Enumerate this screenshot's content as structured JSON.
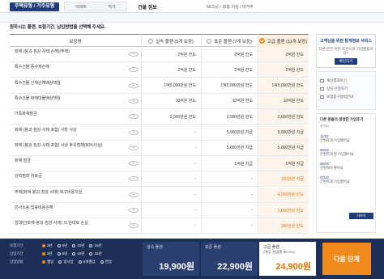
{
  "header": {
    "tab_active": "주택유형 / 거주유형",
    "sub": [
      "아파트",
      "자가"
    ],
    "label": "건물 정보",
    "value": "59.5㎡ / 16층 이상 / 미거주"
  },
  "instruction": "원하시는 플랜, 보험기간, 납입방법을 선택해 주세요.",
  "table": {
    "head": {
      "label": "보장명",
      "plans": [
        {
          "name": "실속 플랜 (5개 보장)",
          "selected": false
        },
        {
          "name": "표준 플랜 (7개 보장)",
          "selected": false
        },
        {
          "name": "고급 플랜 (11개 보장)",
          "selected": true
        }
      ]
    },
    "rows": [
      {
        "name": "화재 (붕괴·침강·사태 손해)(주택)",
        "sub": "",
        "v": [
          "2억원 한도",
          "2억원 한도",
          "2억원 한도"
        ]
      },
      {
        "name": "특수건물 풍수재손해",
        "sub": "",
        "v": [
          "2억원 한도",
          "2억원 한도",
          "2억원 한도"
        ]
      },
      {
        "name": "특수건물 신체손해배상책임",
        "sub": "",
        "v": [
          "1억5,000만원 한도",
          "1억5,000만원 한도",
          "1억5,000만원 한도"
        ]
      },
      {
        "name": "특수건물 화재대물배상책임",
        "sub": "",
        "v": [
          "10억원 한도",
          "10억원 한도",
          "10억원 한도"
        ]
      },
      {
        "name": "가족화재벌금",
        "sub": "",
        "v": [
          "2,000만원 한도",
          "2,000만원 한도",
          "2,000만원 한도"
        ]
      },
      {
        "name": "화재 (붕괴·침강·사태 포함) 사망 사상",
        "sub": "",
        "v": [
          "-",
          "5,000만원 지급",
          "5,000만원 지급"
        ]
      },
      {
        "name": "화재 (붕괴·침강·사태 포함) 사상 후유장해(80%이상)",
        "sub": "",
        "v": [
          "-",
          "5,000만원 지급",
          "5,000만원 지급"
        ]
      },
      {
        "name": "화재 벌금",
        "sub": "",
        "v": [
          "-",
          "1억원 지급",
          "1억원 지급"
        ]
      },
      {
        "name": "강력범죄 위로금",
        "sub": "",
        "v": [
          "-",
          "-",
          "100만원 지급"
        ]
      },
      {
        "name": "주택(화재·붕괴·침강·사태) 복구비용지원",
        "sub": "",
        "v": [
          "-",
          "-",
          "4,000만원 한도"
        ]
      },
      {
        "name": "민사소송 법률비용손해",
        "sub": "",
        "v": [
          "-",
          "-",
          "2,000만원 한도"
        ]
      },
      {
        "name": "임대인(화재·붕괴·침강·사태) 의 임대료 손실",
        "sub": "",
        "v": [
          "-",
          "-",
          "300만원 한도"
        ]
      }
    ]
  },
  "side": {
    "card": {
      "title": "고객님을 위한 통계정보 서비스",
      "text": "다른 분은 어떤 조건으로 가입했을까요?",
      "button": "확인하기"
    },
    "links": [
      "계산결과보기",
      "상담 신청하기",
      "보험청구방법안내"
    ],
    "history": {
      "title": "다른 분들의 생생한 가입후기",
      "sub": "좋아요",
      "entries": [
        {
          "date": "11/23",
          "text": "간편하게 가입했어요"
        },
        {
          "date": "09/23",
          "text": "간편하게 잘 가입했어요"
        },
        {
          "date": "08/23",
          "text": "간편해서 좋아요"
        },
        {
          "date": "07/23",
          "text": "간편하게 가입했어요"
        }
      ],
      "more": "더보기"
    }
  },
  "options": [
    {
      "label": "보험기간",
      "items": [
        "3년",
        "5년",
        "10년",
        "15년"
      ],
      "selected": 0
    },
    {
      "label": "납입기간",
      "items": [
        "3년",
        "5년",
        "10년",
        "15년"
      ],
      "selected": 0
    },
    {
      "label": "납입방법",
      "items": [
        "월납",
        "일시납",
        "6개월납",
        "연납"
      ],
      "selected": 0
    }
  ],
  "prices": [
    {
      "label": "실속 플랜",
      "value": "19,900원",
      "selected": false
    },
    {
      "label": "표준 플랜",
      "value": "22,900원",
      "selected": false
    },
    {
      "label": "고급 플랜",
      "sub": "(예상 환급률 56.1%)",
      "value": "24,900원",
      "selected": true
    }
  ],
  "next": "다음 단계",
  "colors": {
    "navy": "#1d2f57",
    "accent": "#f08a1c"
  }
}
